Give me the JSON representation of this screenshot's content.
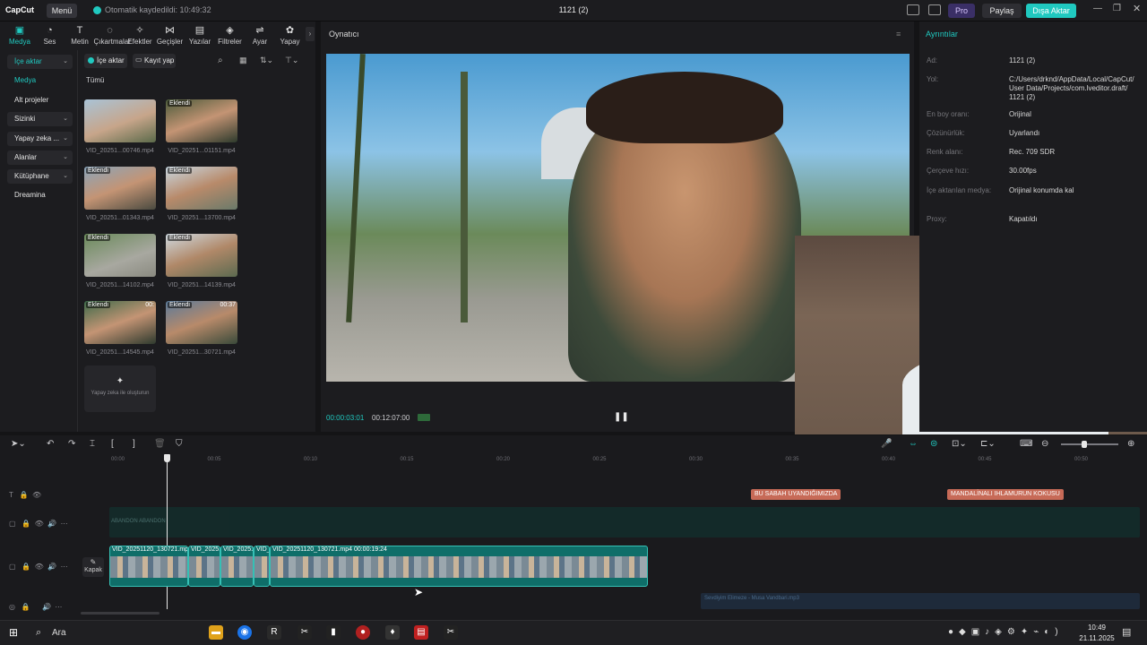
{
  "titlebar": {
    "logo": "CapCut",
    "menu_label": "Menü",
    "autosave": "Otomatik kaydedildi: 10:49:32",
    "project_title": "1121 (2)",
    "pro_label": "Pro",
    "share_label": "Paylaş",
    "export_label": "Dışa Aktar"
  },
  "tabs": [
    {
      "label": "Medya",
      "icon": "media-icon"
    },
    {
      "label": "Ses",
      "icon": "audio-icon"
    },
    {
      "label": "Metin",
      "icon": "text-icon"
    },
    {
      "label": "Çıkartmalar",
      "icon": "sticker-icon"
    },
    {
      "label": "Efektler",
      "icon": "effects-icon"
    },
    {
      "label": "Geçişler",
      "icon": "transitions-icon"
    },
    {
      "label": "Yazılar",
      "icon": "captions-icon"
    },
    {
      "label": "Filtreler",
      "icon": "filters-icon"
    },
    {
      "label": "Ayar",
      "icon": "adjust-icon"
    },
    {
      "label": "Yapay",
      "icon": "ai-icon"
    }
  ],
  "sidebar": {
    "items": [
      {
        "label": "İçe aktar",
        "dropdown": true
      },
      {
        "label": "Medya",
        "dropdown": false
      },
      {
        "label": "Alt projeler",
        "dropdown": false
      },
      {
        "label": "Sizinki",
        "dropdown": true
      },
      {
        "label": "Yapay zeka ...",
        "dropdown": true
      },
      {
        "label": "Alanlar",
        "dropdown": true
      },
      {
        "label": "Kütüphane",
        "dropdown": true
      },
      {
        "label": "Dreamina",
        "dropdown": false
      }
    ]
  },
  "media": {
    "import_button": "İçe aktar",
    "record_button": "Kayıt yap",
    "filter_all": "Tümü",
    "items": [
      {
        "name": "VID_20251...00746.mp4",
        "badge": "",
        "duration": ""
      },
      {
        "name": "VID_20251...01151.mp4",
        "badge": "Eklendi",
        "duration": ""
      },
      {
        "name": "VID_20251...01343.mp4",
        "badge": "Eklendi",
        "duration": ""
      },
      {
        "name": "VID_20251...13700.mp4",
        "badge": "Eklendi",
        "duration": ""
      },
      {
        "name": "VID_20251...14102.mp4",
        "badge": "Eklendi",
        "duration": ""
      },
      {
        "name": "VID_20251...14139.mp4",
        "badge": "Eklendi",
        "duration": ""
      },
      {
        "name": "VID_20251...14545.mp4",
        "badge": "Eklendi",
        "duration": "00:"
      },
      {
        "name": "VID_20251...30721.mp4",
        "badge": "Eklendi",
        "duration": "00:37"
      }
    ],
    "ai_create": "Yapay zeka ile oluşturun"
  },
  "player": {
    "title": "Oynatıcı",
    "current_time": "00:00:03:01",
    "total_time": "00:12:07:00"
  },
  "details": {
    "title": "Ayrıntılar",
    "rows": [
      {
        "key": "Ad:",
        "value": "1121 (2)"
      },
      {
        "key": "Yol:",
        "value": "C:/Users/drknd/AppData/Local/CapCut/ User Data/Projects/com.lveditor.draft/ 1121 (2)"
      },
      {
        "key": "En boy oranı:",
        "value": "Orijinal"
      },
      {
        "key": "Çözünürlük:",
        "value": "Uyarlandı"
      },
      {
        "key": "Renk alanı:",
        "value": "Rec. 709 SDR"
      },
      {
        "key": "Çerçeve hızı:",
        "value": "30.00fps"
      },
      {
        "key": "İçe aktarılan medya:",
        "value": "Orijinal konumda kal"
      },
      {
        "key": "Proxy:",
        "value": "Kapatıldı"
      }
    ]
  },
  "timeline": {
    "ruler": [
      "00:00",
      "00:05",
      "00:10",
      "00:15",
      "00:20",
      "00:25",
      "00:30",
      "00:35",
      "00:40",
      "00:45",
      "00:50"
    ],
    "text_clips": [
      "BU SABAH UYANDIĞIMIZDA",
      "MANDALİNALI IHLAMURUN KOKUSU"
    ],
    "clips": [
      {
        "name": "VID_20251120_130721.mp4"
      },
      {
        "name": "VID_20251"
      },
      {
        "name": "VID_20251"
      },
      {
        "name": "VID_"
      },
      {
        "name": "VID_20251120_130721.mp4  00:00:19:24"
      }
    ],
    "cover_label": "Kapak",
    "audio_clip": "Sevdiyim Elimeze - Musa Vandbari.mp3",
    "top_track_label": "ABANDON ABANDON"
  },
  "taskbar": {
    "search": "Ara",
    "time": "10:49",
    "date": "21.11.2025"
  }
}
